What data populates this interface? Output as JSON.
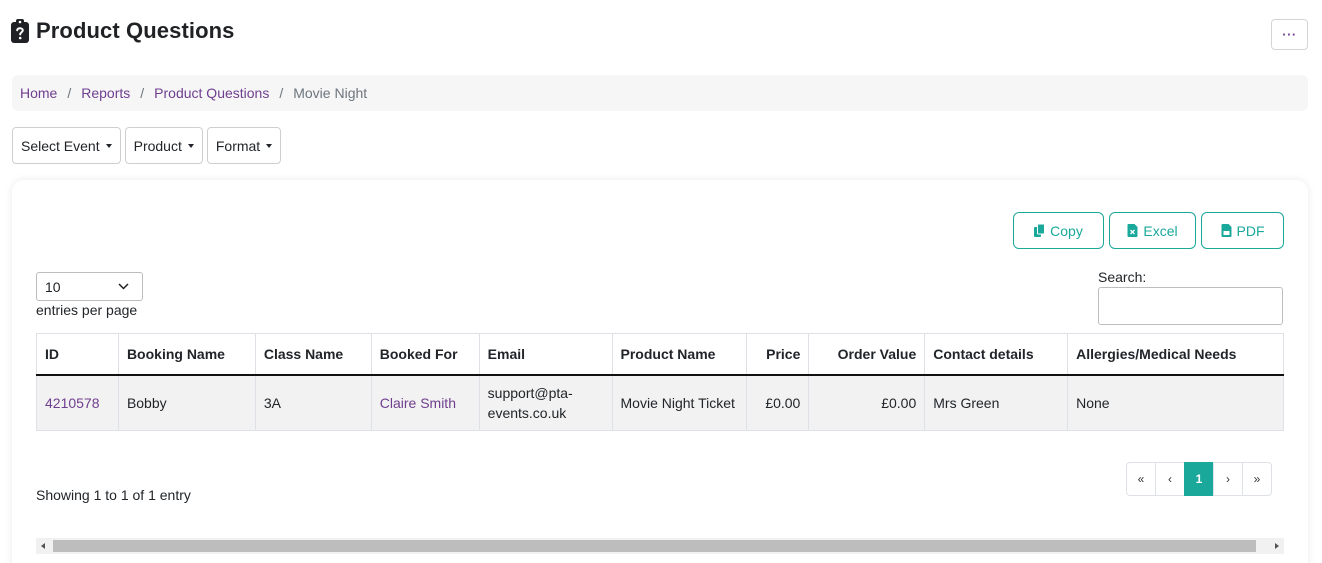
{
  "page": {
    "title": "Product Questions",
    "title_icon": "clipboard-question-icon",
    "more_label": "···"
  },
  "breadcrumb": {
    "home": "Home",
    "reports": "Reports",
    "product_questions": "Product Questions",
    "current": "Movie Night"
  },
  "filters": {
    "event": "Select Event",
    "product": "Product",
    "format": "Format"
  },
  "export": {
    "copy": "Copy",
    "excel": "Excel",
    "pdf": "PDF"
  },
  "table_controls": {
    "length_value": "10",
    "length_label": "entries per page",
    "search_label": "Search:",
    "search_value": ""
  },
  "table": {
    "columns": [
      "ID",
      "Booking Name",
      "Class Name",
      "Booked For",
      "Email",
      "Product Name",
      "Price",
      "Order Value",
      "Contact details",
      "Allergies/Medical Needs"
    ],
    "rows": [
      [
        "4210578",
        "Bobby",
        "3A",
        "Claire Smith",
        "support@pta-events.co.uk",
        "Movie Night Ticket",
        "£0.00",
        "£0.00",
        "Mrs Green",
        "None"
      ]
    ]
  },
  "info": "Showing 1 to 1 of 1 entry",
  "pagination": {
    "first": "«",
    "prev": "‹",
    "current": "1",
    "next": "›",
    "last": "»"
  },
  "colors": {
    "accent": "#1aa89b",
    "link": "#6f3f8f"
  }
}
